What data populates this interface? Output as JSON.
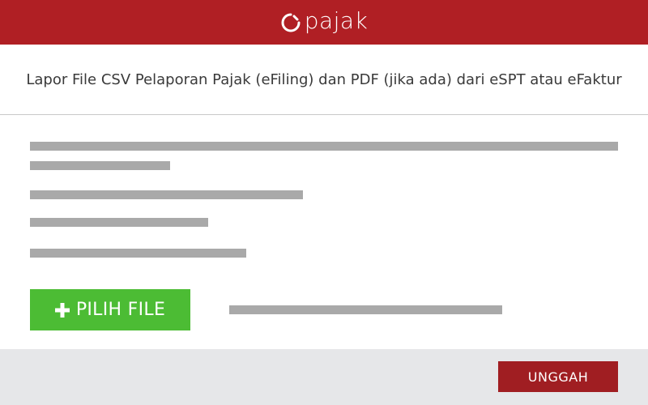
{
  "header": {
    "logo_text": "pajak",
    "logo_icon": "circle-arc-logo-icon",
    "background": "#b01f24"
  },
  "title": "Lapor File CSV Pelaporan Pajak (eFiling) dan PDF (jika ada) dari eSPT atau eFaktur",
  "pick_file_button": {
    "label": "PILIH FILE",
    "icon": "plus-icon",
    "color": "#4cbc34"
  },
  "upload_button": {
    "label": "UNGGAH",
    "color": "#a01e22"
  },
  "colors": {
    "placeholder_bar": "#a9a9a9",
    "footer_background": "#e6e7e9"
  }
}
